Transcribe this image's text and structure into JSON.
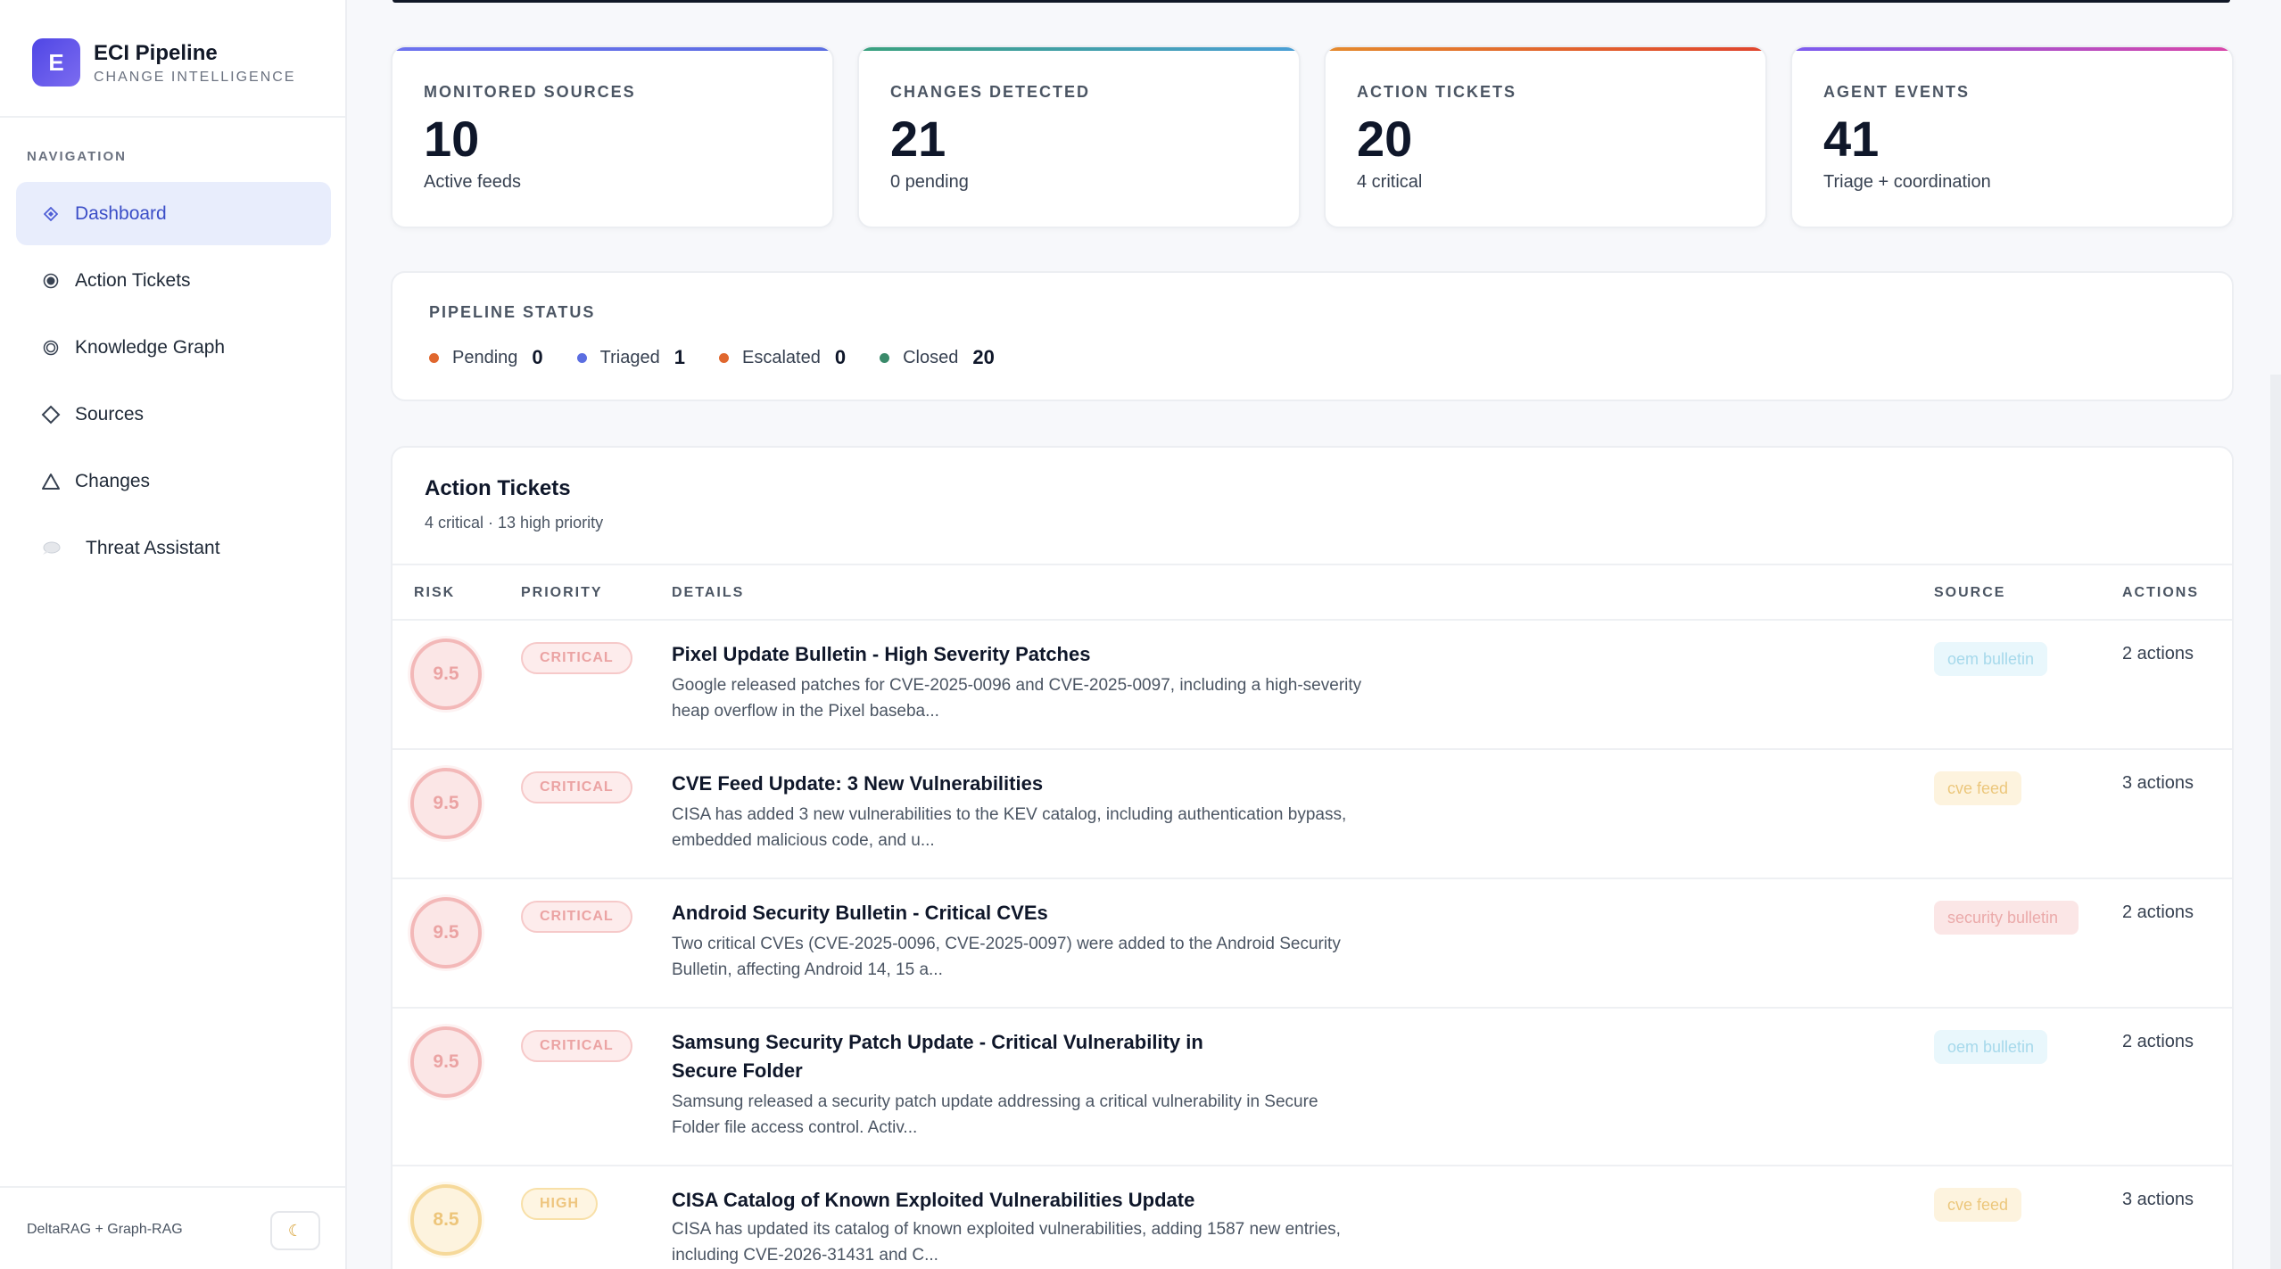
{
  "brand": {
    "logo_letter": "E",
    "title": "ECI Pipeline",
    "subtitle": "CHANGE INTELLIGENCE"
  },
  "navigation": {
    "label": "NAVIGATION",
    "items": [
      {
        "label": "Dashboard",
        "icon": "diamond-icon",
        "active": true
      },
      {
        "label": "Action Tickets",
        "icon": "target-icon",
        "active": false
      },
      {
        "label": "Knowledge Graph",
        "icon": "circle-icon",
        "active": false
      },
      {
        "label": "Sources",
        "icon": "diamond-outline-icon",
        "active": false
      },
      {
        "label": "Changes",
        "icon": "triangle-icon",
        "active": false
      },
      {
        "label": "Threat Assistant",
        "icon": "speech-bubble-icon",
        "active": false
      }
    ]
  },
  "footer": {
    "text": "DeltaRAG + Graph-RAG",
    "theme_icon": "moon-icon"
  },
  "stats": [
    {
      "label": "MONITORED SOURCES",
      "value": "10",
      "sub": "Active feeds",
      "accent": "#6366f1"
    },
    {
      "label": "CHANGES DETECTED",
      "value": "21",
      "sub": "0 pending",
      "accent": "#3aa17e"
    },
    {
      "label": "ACTION TICKETS",
      "value": "20",
      "sub": "4 critical",
      "accent": "#e0672e"
    },
    {
      "label": "AGENT EVENTS",
      "value": "41",
      "sub": "Triage + coordination",
      "accent": "#a855f7"
    }
  ],
  "pipeline": {
    "title": "PIPELINE STATUS",
    "items": [
      {
        "label": "Pending",
        "value": "0",
        "color": "#e0672e"
      },
      {
        "label": "Triaged",
        "value": "1",
        "color": "#5b6ee1"
      },
      {
        "label": "Escalated",
        "value": "0",
        "color": "#e0672e"
      },
      {
        "label": "Closed",
        "value": "20",
        "color": "#3a8a6a"
      }
    ]
  },
  "tickets": {
    "title": "Action Tickets",
    "subtitle": "4 critical · 13 high priority",
    "columns": {
      "risk": "RISK",
      "priority": "PRIORITY",
      "details": "DETAILS",
      "source": "SOURCE",
      "actions": "ACTIONS"
    },
    "rows": [
      {
        "risk": "9.5",
        "priority": "CRITICAL",
        "title": "Pixel Update Bulletin - High Severity Patches",
        "desc": "Google released patches for CVE-2025-0096 and CVE-2025-0097, including a high-severity heap overflow in the Pixel baseba...",
        "source": "oem bulletin",
        "actions": "2 actions"
      },
      {
        "risk": "9.5",
        "priority": "CRITICAL",
        "title": "CVE Feed Update: 3 New Vulnerabilities",
        "desc": "CISA has added 3 new vulnerabilities to the KEV catalog, including authentication bypass, embedded malicious code, and u...",
        "source": "cve feed",
        "actions": "3 actions"
      },
      {
        "risk": "9.5",
        "priority": "CRITICAL",
        "title": "Android Security Bulletin - Critical CVEs",
        "desc": "Two critical CVEs (CVE-2025-0096, CVE-2025-0097) were added to the Android Security Bulletin, affecting Android 14, 15 a...",
        "source": "security bulletin",
        "actions": "2 actions"
      },
      {
        "risk": "9.5",
        "priority": "CRITICAL",
        "title": "Samsung Security Patch Update - Critical Vulnerability in Secure Folder",
        "desc": "Samsung released a security patch update addressing a critical vulnerability in Secure Folder file access control. Activ...",
        "source": "oem bulletin",
        "actions": "2 actions"
      },
      {
        "risk": "8.5",
        "priority": "HIGH",
        "title": "CISA Catalog of Known Exploited Vulnerabilities Update",
        "desc": "CISA has updated its catalog of known exploited vulnerabilities, adding 1587 new entries, including CVE-2026-31431 and C...",
        "source": "cve feed",
        "actions": "3 actions"
      }
    ]
  }
}
